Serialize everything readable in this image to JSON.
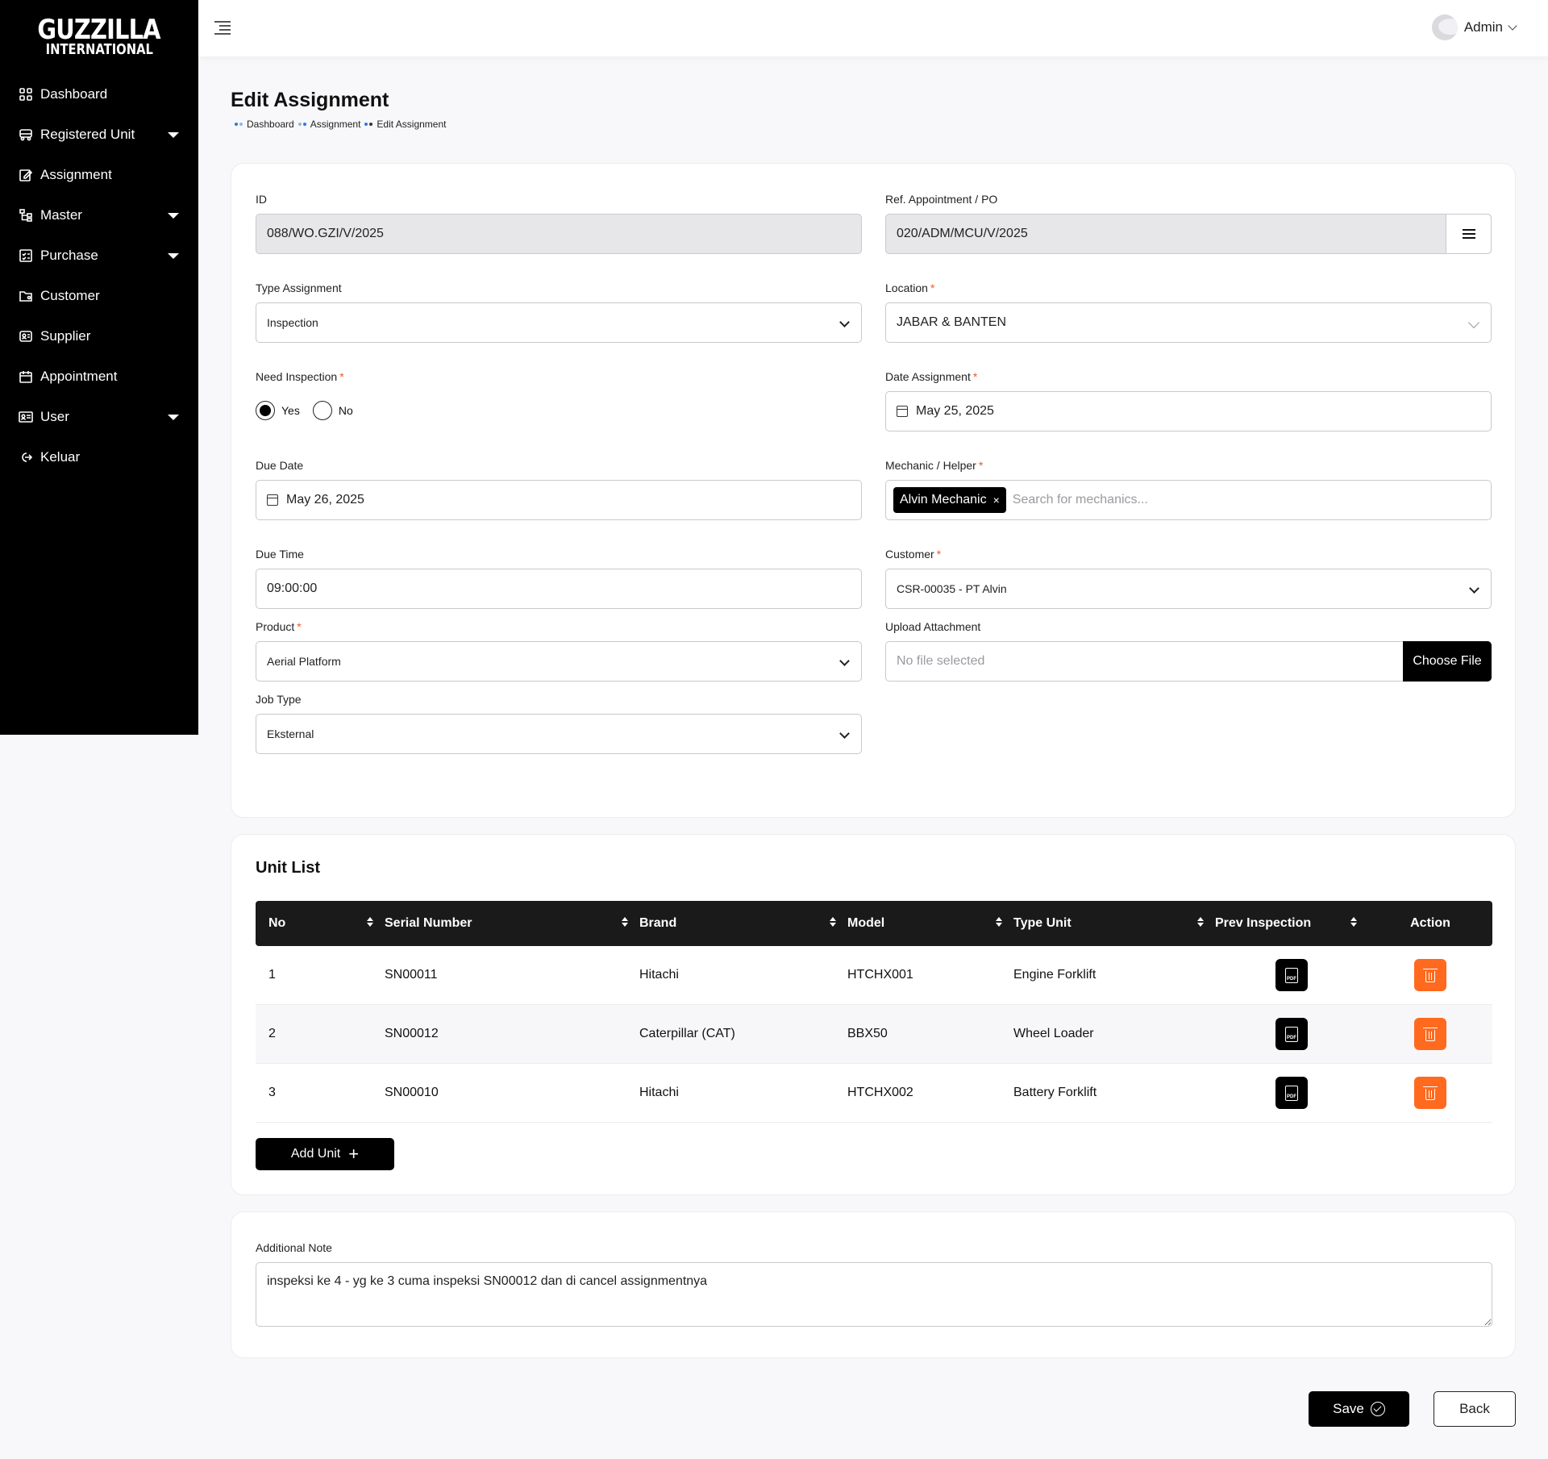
{
  "brand": {
    "line1": "GUZZILLA",
    "line2": "INTERNATIONAL"
  },
  "sidebar": {
    "items": [
      {
        "label": "Dashboard",
        "icon": "dashboard-icon",
        "has_dropdown": false
      },
      {
        "label": "Registered Unit",
        "icon": "truck-icon",
        "has_dropdown": true
      },
      {
        "label": "Assignment",
        "icon": "edit-icon",
        "has_dropdown": false
      },
      {
        "label": "Master",
        "icon": "hierarchy-icon",
        "has_dropdown": true
      },
      {
        "label": "Purchase",
        "icon": "checklist-icon",
        "has_dropdown": true
      },
      {
        "label": "Customer",
        "icon": "folder-user-icon",
        "has_dropdown": false
      },
      {
        "label": "Supplier",
        "icon": "id-card-icon",
        "has_dropdown": false
      },
      {
        "label": "Appointment",
        "icon": "calendar-edit-icon",
        "has_dropdown": false
      },
      {
        "label": "User",
        "icon": "user-card-icon",
        "has_dropdown": true
      },
      {
        "label": "Keluar",
        "icon": "logout-icon",
        "has_dropdown": false
      }
    ]
  },
  "header": {
    "user_name": "Admin"
  },
  "page": {
    "title": "Edit Assignment",
    "breadcrumb": [
      "Dashboard",
      "Assignment",
      "Edit Assignment"
    ]
  },
  "form": {
    "id": {
      "label": "ID",
      "value": "088/WO.GZI/V/2025"
    },
    "ref": {
      "label": "Ref. Appointment / PO",
      "value": "020/ADM/MCU/V/2025"
    },
    "type_assignment": {
      "label": "Type Assignment",
      "value": "Inspection"
    },
    "location": {
      "label": "Location",
      "value": "JABAR & BANTEN"
    },
    "need_inspection": {
      "label": "Need Inspection",
      "options": [
        "Yes",
        "No"
      ],
      "selected": "Yes"
    },
    "date_assignment": {
      "label": "Date Assignment",
      "value": "May 25, 2025"
    },
    "due_date": {
      "label": "Due Date",
      "value": "May 26, 2025"
    },
    "mechanic": {
      "label": "Mechanic / Helper",
      "tags": [
        "Alvin Mechanic"
      ],
      "remove": "×",
      "placeholder": "Search for mechanics..."
    },
    "due_time": {
      "label": "Due Time",
      "value": "09:00:00"
    },
    "customer": {
      "label": "Customer",
      "value": "CSR-00035 - PT Alvin"
    },
    "product": {
      "label": "Product",
      "value": "Aerial Platform"
    },
    "attachment": {
      "label": "Upload Attachment",
      "placeholder": "No file selected",
      "button": "Choose File"
    },
    "job_type": {
      "label": "Job Type",
      "value": "Eksternal"
    },
    "required_mark": "*"
  },
  "unit_list": {
    "title": "Unit List",
    "columns": [
      "No",
      "Serial Number",
      "Brand",
      "Model",
      "Type Unit",
      "Prev Inspection",
      "Action"
    ],
    "rows": [
      {
        "no": "1",
        "serial": "SN00011",
        "brand": "Hitachi",
        "model": "HTCHX001",
        "type": "Engine Forklift"
      },
      {
        "no": "2",
        "serial": "SN00012",
        "brand": "Caterpillar (CAT)",
        "model": "BBX50",
        "type": "Wheel Loader"
      },
      {
        "no": "3",
        "serial": "SN00010",
        "brand": "Hitachi",
        "model": "HTCHX002",
        "type": "Battery Forklift"
      }
    ],
    "pdf_label": "PDF",
    "add_button": "Add Unit",
    "add_plus": "+"
  },
  "note": {
    "label": "Additional Note",
    "value": "inspeksi ke 4 - yg ke 3 cuma inspeksi SN00012 dan di cancel assignmentnya"
  },
  "actions": {
    "save": "Save",
    "back": "Back"
  },
  "colors": {
    "accent": "#000000",
    "danger": "#ff6a1f",
    "required": "#e85b2b"
  }
}
